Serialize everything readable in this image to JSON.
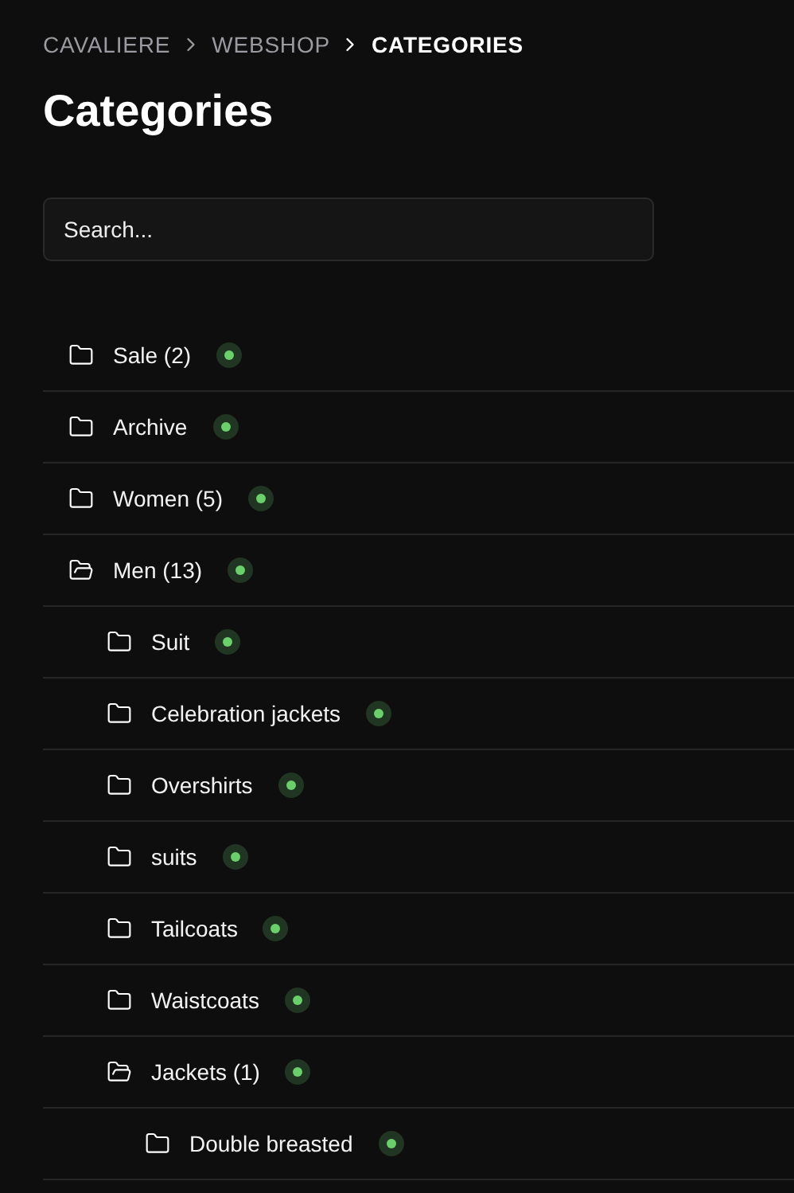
{
  "breadcrumb": [
    {
      "label": "CAVALIERE",
      "selected": false
    },
    {
      "label": "WEBSHOP",
      "selected": false
    },
    {
      "label": "CATEGORIES",
      "selected": true
    }
  ],
  "title": "Categories",
  "search": {
    "placeholder": "Search..."
  },
  "categories": [
    {
      "label": "Sale (2)",
      "expanded": false,
      "active": true
    },
    {
      "label": "Archive",
      "expanded": false,
      "active": true
    },
    {
      "label": "Women (5)",
      "expanded": false,
      "active": true
    },
    {
      "label": "Men (13)",
      "expanded": true,
      "active": true,
      "children": [
        {
          "label": "Suit",
          "expanded": false,
          "active": true
        },
        {
          "label": "Celebration jackets",
          "expanded": false,
          "active": true
        },
        {
          "label": "Overshirts",
          "expanded": false,
          "active": true
        },
        {
          "label": "suits",
          "expanded": false,
          "active": true
        },
        {
          "label": "Tailcoats",
          "expanded": false,
          "active": true
        },
        {
          "label": "Waistcoats",
          "expanded": false,
          "active": true
        },
        {
          "label": "Jackets (1)",
          "expanded": true,
          "active": true,
          "children": [
            {
              "label": "Double breasted",
              "expanded": false,
              "active": true
            }
          ]
        }
      ]
    }
  ]
}
